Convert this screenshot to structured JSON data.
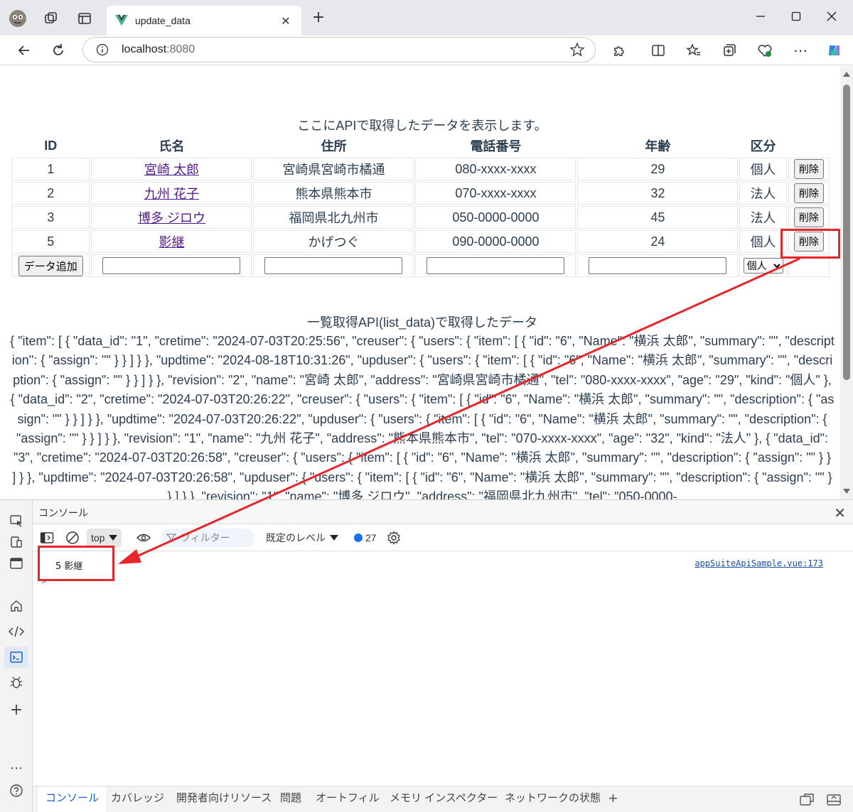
{
  "browser": {
    "tab_title": "update_data",
    "url_host": "localhost",
    "url_port": ":8080"
  },
  "page": {
    "caption": "ここにAPIで取得したデータを表示します。",
    "headers": [
      "ID",
      "氏名",
      "住所",
      "電話番号",
      "年齢",
      "区分"
    ],
    "rows": [
      {
        "id": "1",
        "name": "宮崎 太郎",
        "address": "宮崎県宮崎市橘通",
        "tel": "080-xxxx-xxxx",
        "age": "29",
        "kind": "個人",
        "delete": "削除"
      },
      {
        "id": "2",
        "name": "九州 花子",
        "address": "熊本県熊本市",
        "tel": "070-xxxx-xxxx",
        "age": "32",
        "kind": "法人",
        "delete": "削除"
      },
      {
        "id": "3",
        "name": "博多 ジロウ",
        "address": "福岡県北九州市",
        "tel": "050-0000-0000",
        "age": "45",
        "kind": "法人",
        "delete": "削除"
      },
      {
        "id": "5",
        "name": "影継",
        "address": "かげつぐ",
        "tel": "090-0000-0000",
        "age": "24",
        "kind": "個人",
        "delete": "削除"
      }
    ],
    "add_button": "データ追加",
    "kind_select": "個人",
    "list_title": "一覧取得API(list_data)で取得したデータ",
    "json_text": "{ \"item\": [ { \"data_id\": \"1\", \"cretime\": \"2024-07-03T20:25:56\", \"creuser\": { \"users\": { \"item\": [ { \"id\": \"6\", \"Name\": \"横浜 太郎\", \"summary\": \"\", \"description\": { \"assign\": \"\" } } ] } }, \"updtime\": \"2024-08-18T10:31:26\", \"upduser\": { \"users\": { \"item\": [ { \"id\": \"6\", \"Name\": \"横浜 太郎\", \"summary\": \"\", \"description\": { \"assign\": \"\" } } ] } }, \"revision\": \"2\", \"name\": \"宮崎 太郎\", \"address\": \"宮崎県宮崎市橘通\", \"tel\": \"080-xxxx-xxxx\", \"age\": \"29\", \"kind\": \"個人\" }, { \"data_id\": \"2\", \"cretime\": \"2024-07-03T20:26:22\", \"creuser\": { \"users\": { \"item\": [ { \"id\": \"6\", \"Name\": \"横浜 太郎\", \"summary\": \"\", \"description\": { \"assign\": \"\" } } ] } }, \"updtime\": \"2024-07-03T20:26:22\", \"upduser\": { \"users\": { \"item\": [ { \"id\": \"6\", \"Name\": \"横浜 太郎\", \"summary\": \"\", \"description\": { \"assign\": \"\" } } ] } }, \"revision\": \"1\", \"name\": \"九州 花子\", \"address\": \"熊本県熊本市\", \"tel\": \"070-xxxx-xxxx\", \"age\": \"32\", \"kind\": \"法人\" }, { \"data_id\": \"3\", \"cretime\": \"2024-07-03T20:26:58\", \"creuser\": { \"users\": { \"item\": [ { \"id\": \"6\", \"Name\": \"横浜 太郎\", \"summary\": \"\", \"description\": { \"assign\": \"\" } } ] } }, \"updtime\": \"2024-07-03T20:26:58\", \"upduser\": { \"users\": { \"item\": [ { \"id\": \"6\", \"Name\": \"横浜 太郎\", \"summary\": \"\", \"description\": { \"assign\": \"\" } } ] } }, \"revision\": \"1\", \"name\": \"博多 ジロウ\", \"address\": \"福岡県北九州市\", \"tel\": \"050-0000-"
  },
  "devtools": {
    "panel_title": "コンソール",
    "context": "top",
    "filter_placeholder": "フィルター",
    "level": "既定のレベル",
    "message_count": "27",
    "log_message": "5 影継",
    "log_source": "appSuiteApiSample.vue:173",
    "prompt": ">",
    "tabs": [
      "コンソール",
      "カバレッジ",
      "開発者向けリソース",
      "問題",
      "オートフィル",
      "メモリ インスペクター",
      "ネットワークの状態"
    ]
  },
  "colors": {
    "highlight": "#e5262a",
    "link": "#551a8b",
    "active_tab": "#1a60c8"
  }
}
